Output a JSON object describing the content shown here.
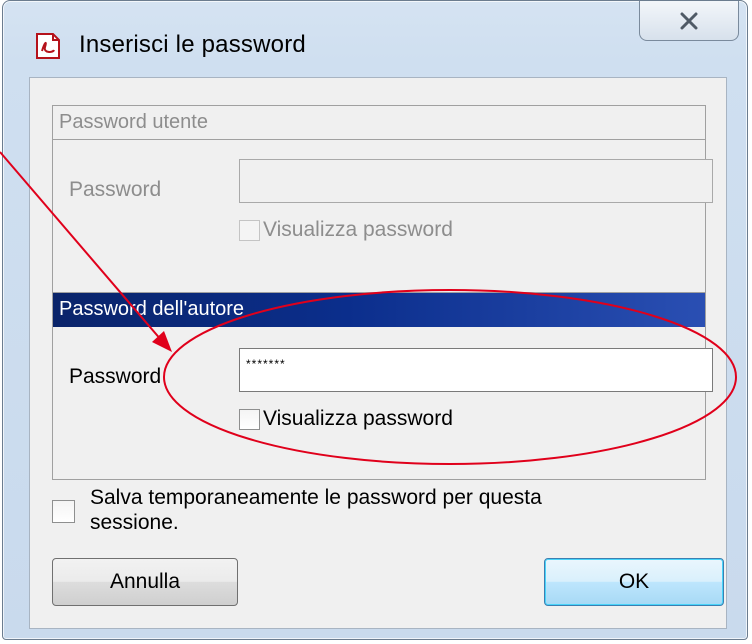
{
  "window": {
    "title": "Inserisci le password",
    "close_glyph": "✕",
    "title_icon": "pdf-document-icon"
  },
  "user_password_group": {
    "header": "Password utente",
    "label": "Password",
    "value": "",
    "show_password_label": "Visualizza password"
  },
  "author_password_group": {
    "header": "Password dell'autore",
    "label": "Password",
    "value": "*******",
    "show_password_label": "Visualizza password"
  },
  "save_session": {
    "label_line1": "Salva temporaneamente le password per questa",
    "label_line2": "sessione."
  },
  "buttons": {
    "cancel": "Annulla",
    "ok": "OK"
  },
  "colors": {
    "annotation": "#e0001b",
    "group_header_active": "#0a246a"
  }
}
